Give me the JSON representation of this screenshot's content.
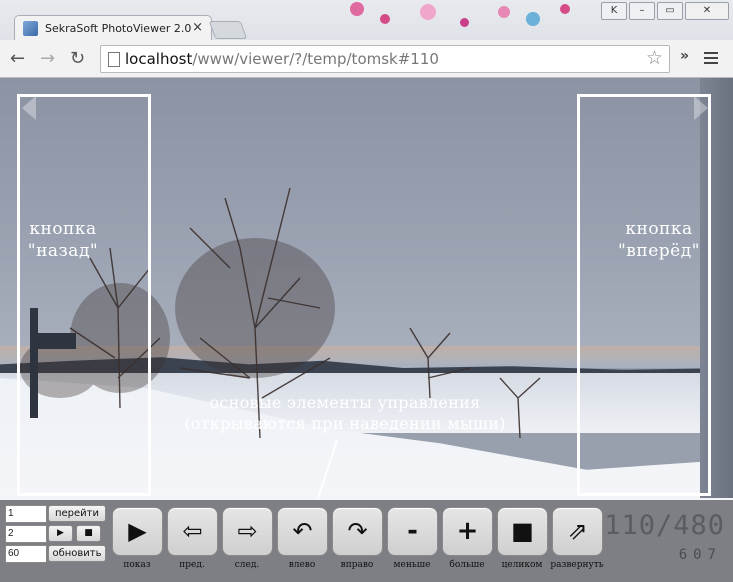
{
  "browser": {
    "tab_title": "SekraSoft PhotoViewer 2.0",
    "tab_close": "×",
    "url_host": "localhost",
    "url_path": "/www/viewer/?/temp/tomsk#110",
    "window_buttons": [
      "K",
      "–",
      "▭",
      "✕"
    ],
    "back_glyph": "←",
    "forward_glyph": "→",
    "reload_glyph": "↻",
    "bookmark_glyph": "☆",
    "ext_glyph": "»"
  },
  "viewer": {
    "prev_label_line1": "кнопка",
    "prev_label_line2": "\"назад\"",
    "next_label_line1": "кнопка",
    "next_label_line2": "\"вперёд\"",
    "annotation_line1": "основые элементы управления",
    "annotation_line2": "(открываются при наведении мыши)"
  },
  "controls": {
    "goto_value": "1",
    "goto_label": "перейти",
    "interval_value": "2",
    "play_small": "▶",
    "stop_small": "■",
    "refresh_value": "60",
    "refresh_label": "обновить",
    "buttons": [
      {
        "glyph": "▶",
        "caption": "показ"
      },
      {
        "glyph": "⇦",
        "caption": "пред."
      },
      {
        "glyph": "⇨",
        "caption": "след."
      },
      {
        "glyph": "↶",
        "caption": "влево"
      },
      {
        "glyph": "↷",
        "caption": "вправо"
      },
      {
        "glyph": "-",
        "caption": "меньше"
      },
      {
        "glyph": "+",
        "caption": "больше"
      },
      {
        "glyph": "■",
        "caption": "целиком"
      },
      {
        "glyph": "⇗",
        "caption": "развернуть"
      }
    ],
    "counter": "110/480",
    "sub_counter": "607"
  }
}
